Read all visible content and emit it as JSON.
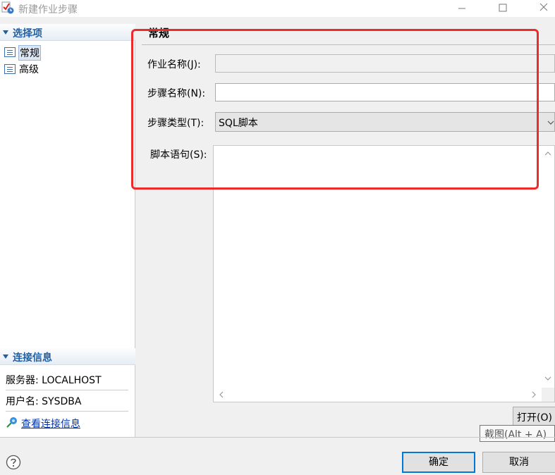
{
  "window": {
    "title": "新建作业步骤"
  },
  "left": {
    "select_section": {
      "title": "选择项"
    },
    "nav_items": [
      {
        "label": "常规",
        "selected": true
      },
      {
        "label": "高级",
        "selected": false
      }
    ],
    "connection_section": {
      "title": "连接信息"
    },
    "server": "服务器: LOCALHOST",
    "user": "用户名: SYSDBA",
    "view_link": "查看连接信息"
  },
  "right": {
    "section_title": "常规",
    "job_name_label": "作业名称(J):",
    "job_name_value": "",
    "step_name_label": "步骤名称(N):",
    "step_name_value": "",
    "step_type_label": "步骤类型(T):",
    "step_type_value": "SQL脚本",
    "script_label": "脚本语句(S):",
    "open_button": "打开(O)",
    "tooltip": "截图(Alt + A)"
  },
  "footer": {
    "ok_label": "确定",
    "cancel_label": "取消"
  },
  "colors": {
    "annotation": "#ee2b2b",
    "accent": "#1f5fa3",
    "link": "#0033aa",
    "default_button_border": "#0078d7"
  }
}
